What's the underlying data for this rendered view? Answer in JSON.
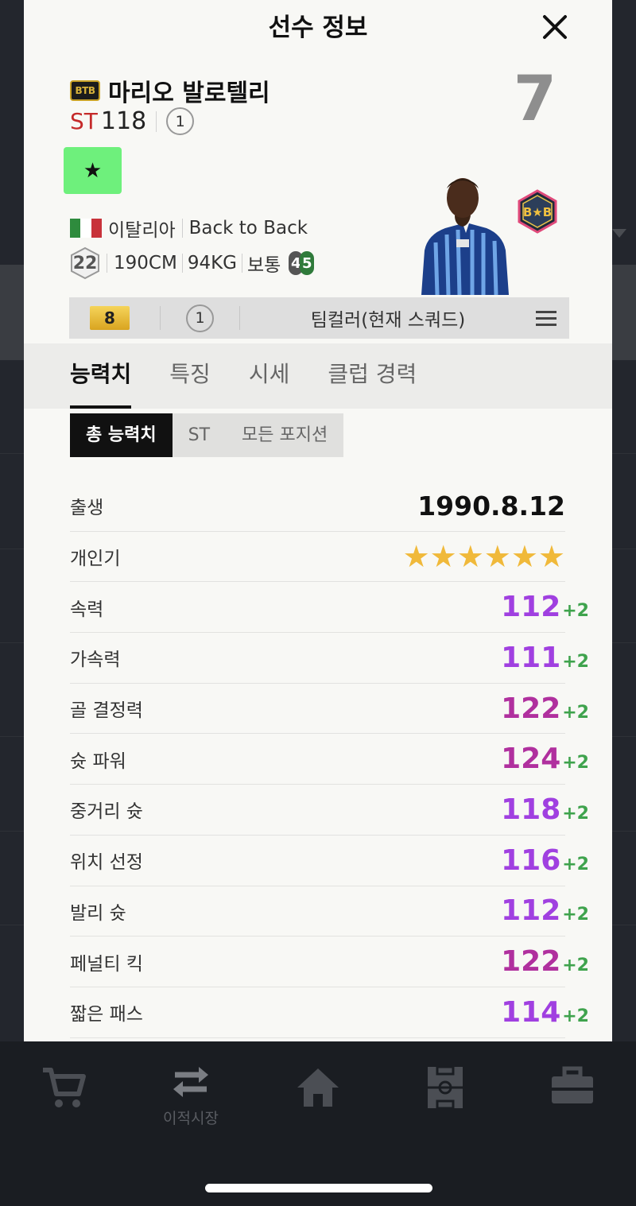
{
  "modal": {
    "title": "선수 정보"
  },
  "player": {
    "season": "BTB",
    "name": "마리오 발로텔리",
    "position": "ST",
    "ovr": "118",
    "upgrade": "1",
    "number": "7",
    "nation": "이탈리아",
    "club": "Back to Back",
    "age": "22",
    "height": "190CM",
    "weight": "94KG",
    "body_type": "보통",
    "foot_left": "4",
    "foot_right": "5"
  },
  "util": {
    "level": "8",
    "upgrade": "1",
    "team_color": "팀컬러(현재 스쿼드)"
  },
  "tabs": [
    {
      "label": "능력치"
    },
    {
      "label": "특징"
    },
    {
      "label": "시세"
    },
    {
      "label": "클럽 경력"
    }
  ],
  "segments": [
    {
      "label": "총 능력치"
    },
    {
      "label": "ST"
    },
    {
      "label": "모든 포지션"
    }
  ],
  "stats": {
    "birth": {
      "label": "출생",
      "value": "1990.8.12"
    },
    "popularity": {
      "label": "개인기",
      "stars": "★★★★★★",
      "rating": 6
    },
    "rows": [
      {
        "label": "속력",
        "value": "112",
        "plus": "+2",
        "color": "#a040e0"
      },
      {
        "label": "가속력",
        "value": "111",
        "plus": "+2",
        "color": "#a040e0"
      },
      {
        "label": "골 결정력",
        "value": "122",
        "plus": "+2",
        "color": "#b0309e"
      },
      {
        "label": "슛 파워",
        "value": "124",
        "plus": "+2",
        "color": "#b0309e"
      },
      {
        "label": "중거리 슛",
        "value": "118",
        "plus": "+2",
        "color": "#a040e0"
      },
      {
        "label": "위치 선정",
        "value": "116",
        "plus": "+2",
        "color": "#a040e0"
      },
      {
        "label": "발리 슛",
        "value": "112",
        "plus": "+2",
        "color": "#a040e0"
      },
      {
        "label": "페널티 킥",
        "value": "122",
        "plus": "+2",
        "color": "#b0309e"
      },
      {
        "label": "짧은 패스",
        "value": "114",
        "plus": "+2",
        "color": "#a040e0"
      }
    ]
  },
  "bottom_nav": {
    "transfer_label": "이적시장"
  },
  "colors": {
    "star_button": "#6ef07c",
    "position_red": "#c52a2a",
    "plus_green": "#3fa34d",
    "star_gold": "#f0b93a"
  }
}
